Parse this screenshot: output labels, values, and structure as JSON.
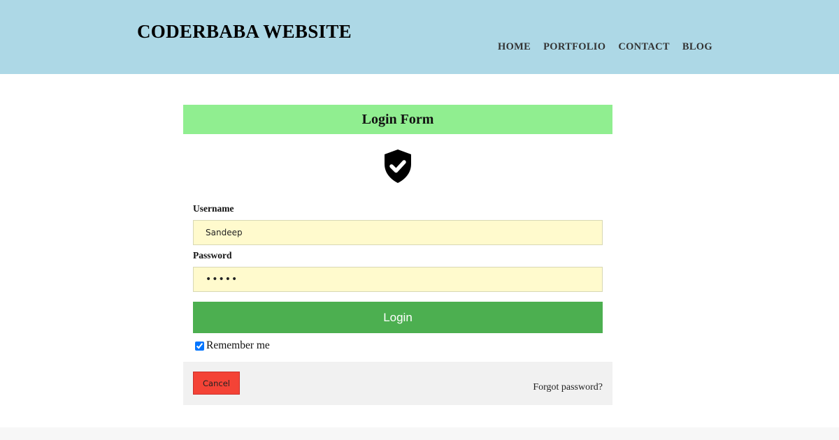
{
  "header": {
    "site_title": "CODERBABA WEBSITE",
    "background_color": "#add8e6",
    "nav": [
      {
        "label": "HOME"
      },
      {
        "label": "PORTFOLIO"
      },
      {
        "label": "CONTACT"
      },
      {
        "label": "BLOG"
      }
    ]
  },
  "login_form": {
    "title": "Login Form",
    "title_bar_color": "#90ee90",
    "icon": "shield-check-icon",
    "username": {
      "label": "Username",
      "value": "Sandeep"
    },
    "password": {
      "label": "Password",
      "value": "•••••"
    },
    "input_background": "#fffacd",
    "login_button": {
      "label": "Login",
      "color": "#4caf50"
    },
    "remember_me": {
      "label": "Remember me",
      "checked": true
    },
    "cancel_button": {
      "label": "Cancel",
      "color": "#f44336"
    },
    "forgot_password": "Forgot password?"
  }
}
